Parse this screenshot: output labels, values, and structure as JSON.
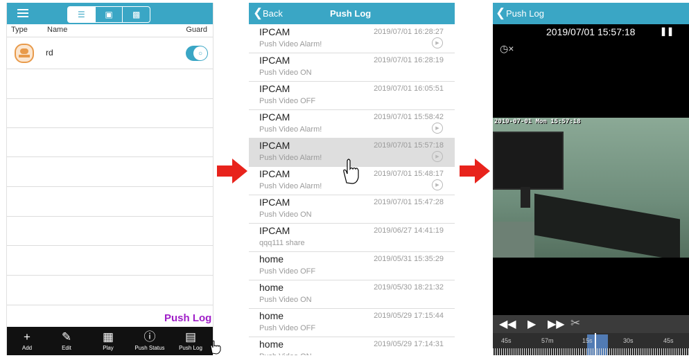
{
  "colors": {
    "accent": "#3aa6c5",
    "arrow": "#e8231c",
    "highlight": "#a020c8"
  },
  "panel1": {
    "menu_icon": "hamburger-icon",
    "seg_icons": [
      "list-icon",
      "folder-icon",
      "star-folder-icon"
    ],
    "headers": {
      "type": "Type",
      "name": "Name",
      "guard": "Guard"
    },
    "devices": [
      {
        "name": "rd",
        "icon": "camera-device-icon",
        "guard": true
      }
    ],
    "push_log_callout": "Push Log",
    "toolbar": [
      {
        "label": "Add",
        "icon": "plus-icon"
      },
      {
        "label": "Edit",
        "icon": "pencil-icon"
      },
      {
        "label": "Play",
        "icon": "grid-play-icon"
      },
      {
        "label": "Push Status",
        "icon": "exclamation-bubble-icon"
      },
      {
        "label": "Push Log",
        "icon": "message-list-icon"
      }
    ]
  },
  "panel2": {
    "back_label": "Back",
    "title": "Push Log",
    "items": [
      {
        "name": "IPCAM",
        "status": "Push Video Alarm!",
        "time": "2019/07/01 16:28:27",
        "play": true
      },
      {
        "name": "IPCAM",
        "status": "Push Video ON",
        "time": "2019/07/01 16:28:19",
        "play": false
      },
      {
        "name": "IPCAM",
        "status": "Push Video OFF",
        "time": "2019/07/01 16:05:51",
        "play": false
      },
      {
        "name": "IPCAM",
        "status": "Push Video Alarm!",
        "time": "2019/07/01 15:58:42",
        "play": true
      },
      {
        "name": "IPCAM",
        "status": "Push Video Alarm!",
        "time": "2019/07/01 15:57:18",
        "play": true,
        "selected": true
      },
      {
        "name": "IPCAM",
        "status": "Push Video Alarm!",
        "time": "2019/07/01 15:48:17",
        "play": true
      },
      {
        "name": "IPCAM",
        "status": "Push Video ON",
        "time": "2019/07/01 15:47:28",
        "play": false
      },
      {
        "name": "IPCAM",
        "status": "qqq111 share",
        "time": "2019/06/27 14:41:19",
        "play": false
      },
      {
        "name": "home",
        "status": "Push Video OFF",
        "time": "2019/05/31 15:35:29",
        "play": false
      },
      {
        "name": "home",
        "status": "Push Video ON",
        "time": "2019/05/30 18:21:32",
        "play": false
      },
      {
        "name": "home",
        "status": "Push Video OFF",
        "time": "2019/05/29 17:15:44",
        "play": false
      },
      {
        "name": "home",
        "status": "Push Video ON",
        "time": "2019/05/29 17:14:31",
        "play": false
      }
    ]
  },
  "panel3": {
    "back_label": "Push Log",
    "timestamp": "2019/07/01 15:57:18",
    "pause_icon": "pause-icon",
    "mute_icon": "speaker-mute-icon",
    "osd": "2019-07-01 Mon 15:57:18",
    "controls": [
      "rewind-icon",
      "play-icon",
      "fast-forward-icon",
      "scissors-icon"
    ],
    "timeline_labels": [
      "45s",
      "57m",
      "15s",
      "30s",
      "45s"
    ]
  }
}
